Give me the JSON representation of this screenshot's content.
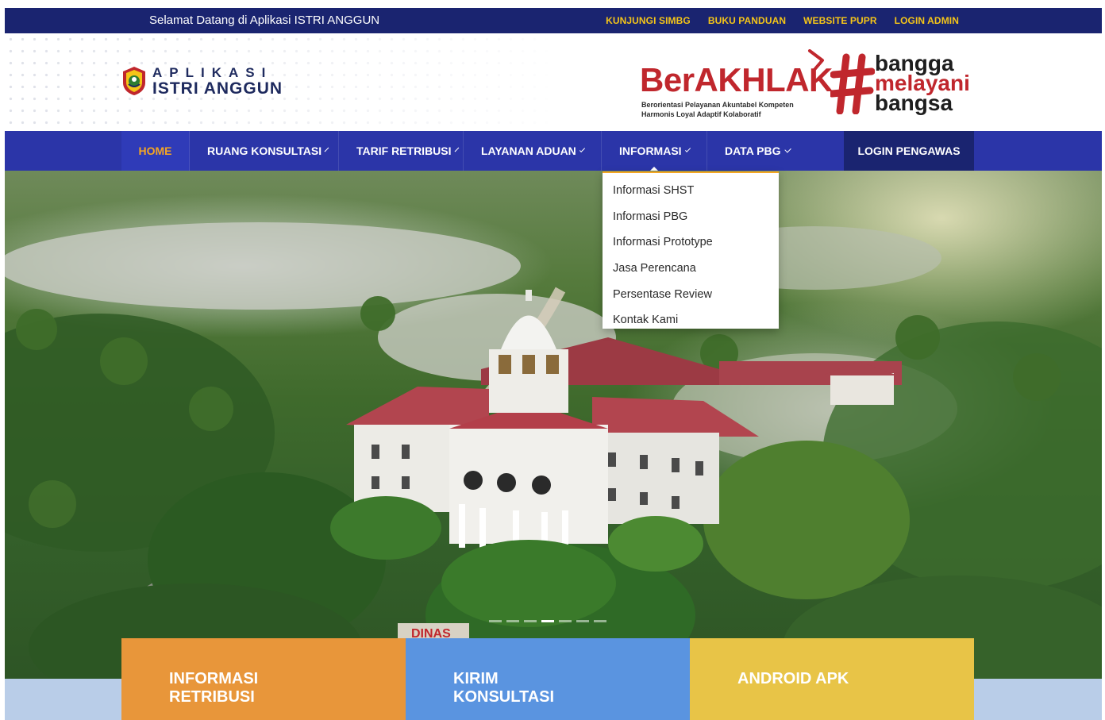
{
  "topbar": {
    "welcome": "Selamat Datang di Aplikasi ISTRI ANGGUN",
    "links": [
      "KUNJUNGI SIMBG",
      "BUKU PANDUAN",
      "WEBSITE PUPR",
      "LOGIN ADMIN"
    ]
  },
  "logo": {
    "line1": "APLIKASI",
    "line2": "ISTRI ANGGUN"
  },
  "banner": {
    "berakhlak_ber": "Ber",
    "berakhlak_akhlak": "AKHLAK",
    "tagline1": "Berorientasi Pelayanan Akuntabel Kompeten",
    "tagline2": "Harmonis Loyal Adaptif Kolaboratif",
    "bangga1": "bangga",
    "bangga2": "melayani",
    "bangga3": "bangsa"
  },
  "nav": {
    "items": [
      {
        "label": "HOME"
      },
      {
        "label": "RUANG KONSULTASI"
      },
      {
        "label": "TARIF RETRIBUSI"
      },
      {
        "label": "LAYANAN ADUAN"
      },
      {
        "label": "INFORMASI"
      },
      {
        "label": "DATA PBG"
      }
    ],
    "login": "LOGIN PENGAWAS"
  },
  "dropdown": {
    "items": [
      "Informasi SHST",
      "Informasi PBG",
      "Informasi Prototype",
      "Jasa Perencana",
      "Persentase Review",
      "Kontak Kami"
    ]
  },
  "hero": {
    "sign": "DINAS",
    "slides_total": 7,
    "active_slide": 4
  },
  "cards": [
    {
      "line1": "INFORMASI",
      "line2": "RETRIBUSI"
    },
    {
      "line1": "KIRIM",
      "line2": "KONSULTASI"
    },
    {
      "line1": "ANDROID APK",
      "line2": ""
    }
  ],
  "colors": {
    "topbar": "#1a2470",
    "nav": "#2b35a8",
    "accent": "#f5a623",
    "brand_red": "#c0272d",
    "card_orange": "#e8963a",
    "card_blue": "#5a94e0",
    "card_yellow": "#e8c447"
  }
}
